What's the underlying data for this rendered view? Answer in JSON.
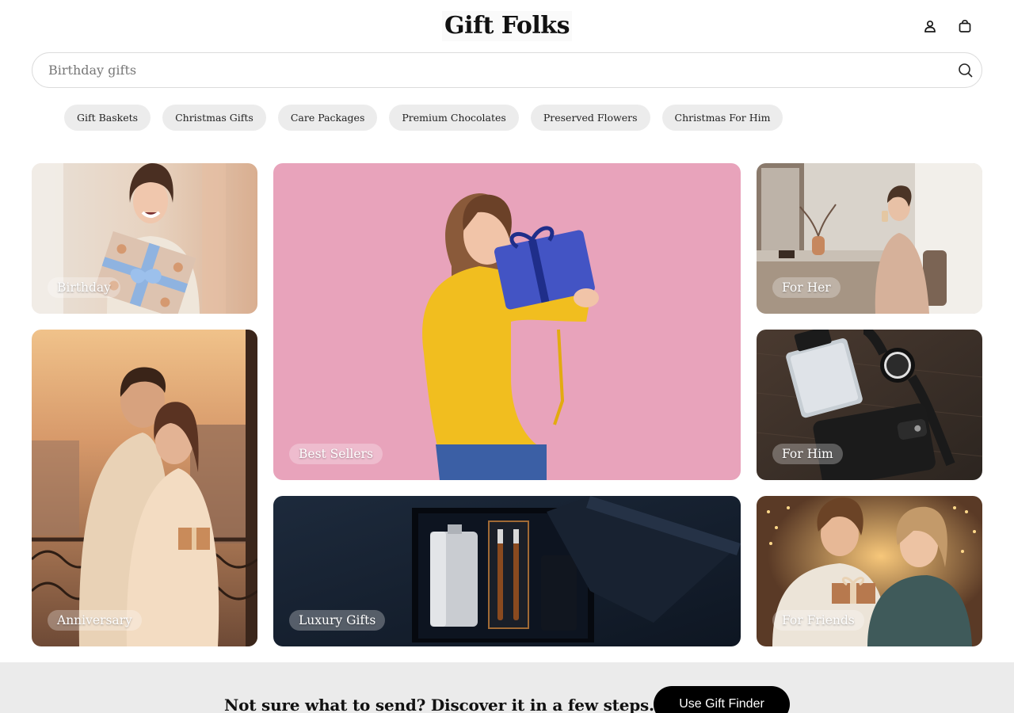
{
  "header": {
    "logo": "Gift Folks",
    "icons": {
      "account": "person-icon",
      "bag": "shopping-bag-icon"
    }
  },
  "search": {
    "placeholder": "Birthday gifts",
    "icon": "search-icon"
  },
  "chips": [
    {
      "label": "Gift Baskets"
    },
    {
      "label": "Christmas Gifts"
    },
    {
      "label": "Care Packages"
    },
    {
      "label": "Premium Chocolates"
    },
    {
      "label": "Preserved Flowers"
    },
    {
      "label": "Christmas For Him"
    }
  ],
  "tiles": {
    "birthday": {
      "label": "Birthday"
    },
    "anniversary": {
      "label": "Anniversary"
    },
    "best_sellers": {
      "label": "Best Sellers"
    },
    "luxury": {
      "label": "Luxury Gifts"
    },
    "for_her": {
      "label": "For Her"
    },
    "for_him": {
      "label": "For Him"
    },
    "for_friends": {
      "label": "For Friends"
    }
  },
  "banner": {
    "text": "Not sure what to send? Discover it in a few steps.",
    "button": "Use Gift Finder"
  },
  "colors": {
    "chip_bg": "#ececec",
    "best_sellers_bg": "#e8a3bb",
    "banner_bg": "#ebebeb",
    "button_bg": "#000000"
  }
}
